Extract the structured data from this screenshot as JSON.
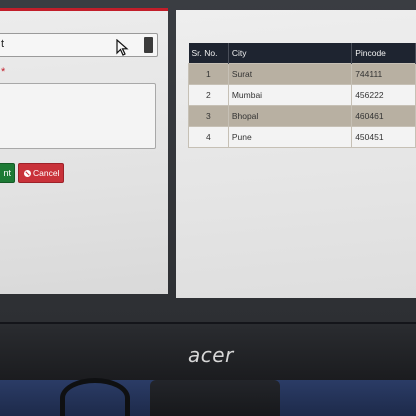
{
  "form": {
    "select_value": "t",
    "required_mark": "*",
    "submit_label": "nt",
    "cancel_label": "Cancel"
  },
  "table": {
    "headers": [
      "Sr. No.",
      "City",
      "Pincode"
    ],
    "rows": [
      {
        "sr": "1",
        "city": "Surat",
        "pincode": "744111"
      },
      {
        "sr": "2",
        "city": "Mumbai",
        "pincode": "456222"
      },
      {
        "sr": "3",
        "city": "Bhopal",
        "pincode": "460461"
      },
      {
        "sr": "4",
        "city": "Pune",
        "pincode": "450451"
      }
    ]
  },
  "monitor": {
    "brand": "acer"
  },
  "colors": {
    "accent_red": "#c21e2a",
    "submit_green": "#1d7a35",
    "cancel_red": "#c9323a",
    "table_header": "#1e2430",
    "row_shade": "#b8b0a2"
  }
}
